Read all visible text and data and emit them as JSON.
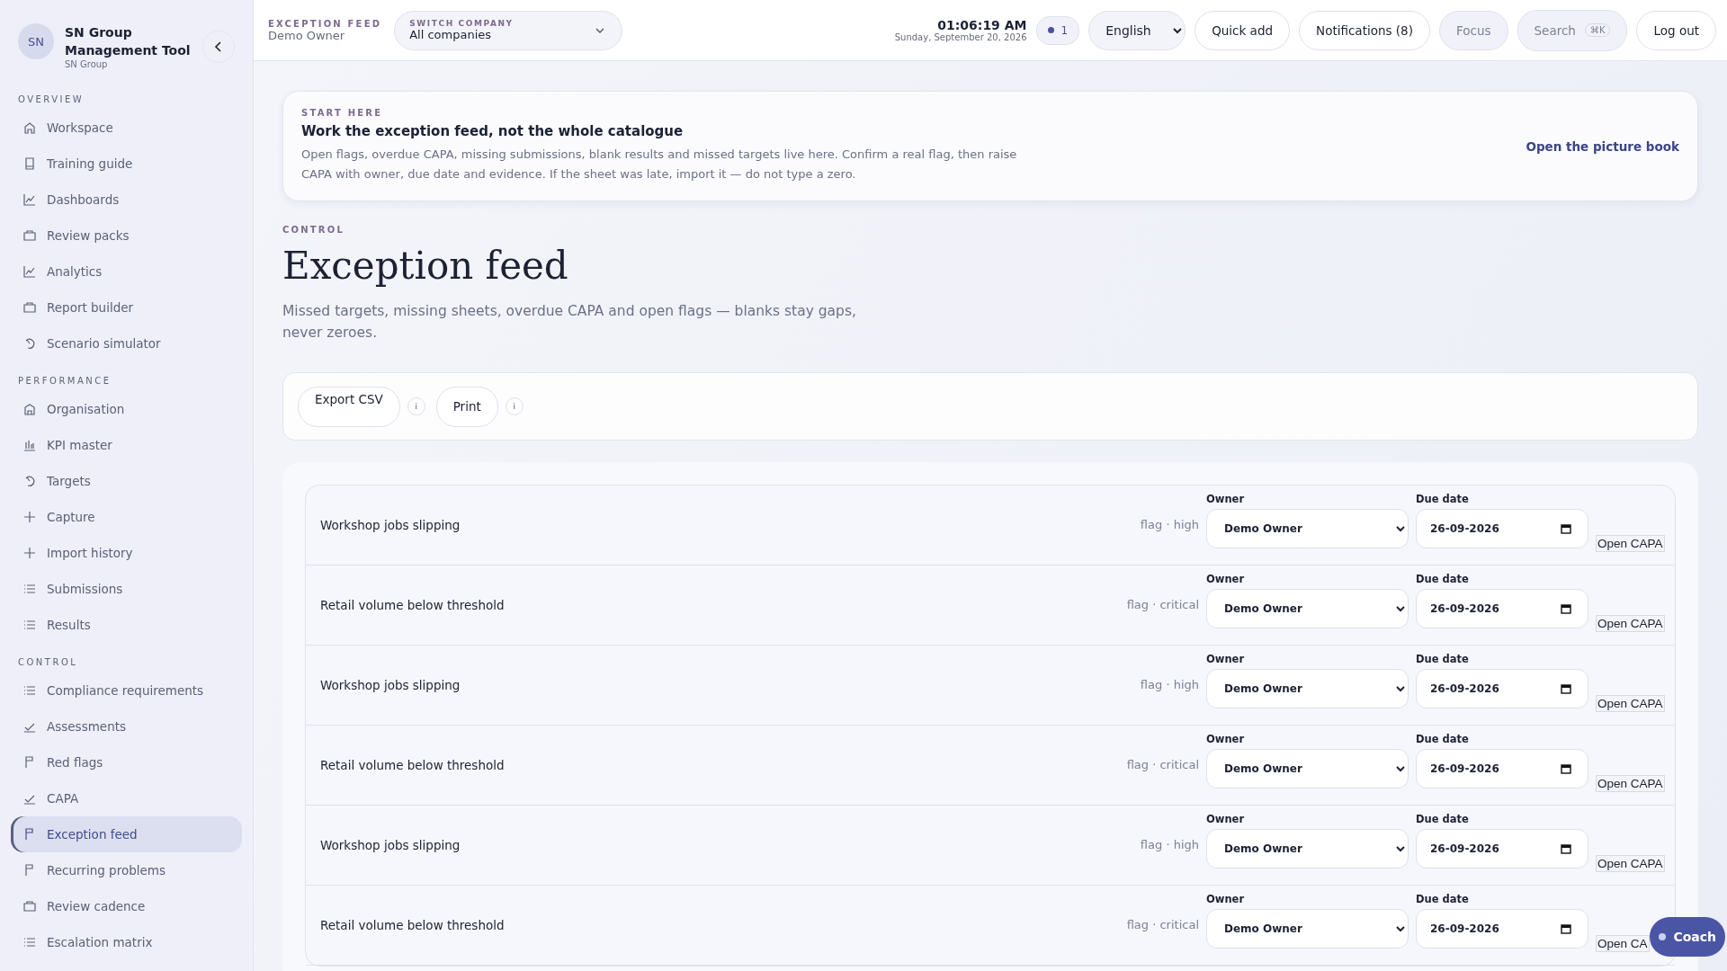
{
  "sidebar": {
    "avatar": "SN",
    "title": "SN Group Management Tool",
    "subtitle": "SN Group",
    "sections": [
      {
        "heading": "OVERVIEW",
        "items": [
          {
            "label": "Workspace",
            "kind": "home",
            "selected": false
          },
          {
            "label": "Training guide",
            "kind": "book",
            "selected": false
          },
          {
            "label": "Dashboards",
            "kind": "chart",
            "selected": false
          },
          {
            "label": "Review packs",
            "kind": "folder",
            "selected": false
          },
          {
            "label": "Analytics",
            "kind": "chart",
            "selected": false
          },
          {
            "label": "Report builder",
            "kind": "folder",
            "selected": false
          },
          {
            "label": "Scenario simulator",
            "kind": "gauge",
            "selected": false
          }
        ]
      },
      {
        "heading": "PERFORMANCE",
        "items": [
          {
            "label": "Organisation",
            "kind": "building",
            "selected": false
          },
          {
            "label": "KPI master",
            "kind": "bars",
            "selected": false
          },
          {
            "label": "Targets",
            "kind": "gauge",
            "selected": false
          },
          {
            "label": "Capture",
            "kind": "plus",
            "selected": false
          },
          {
            "label": "Import history",
            "kind": "plus",
            "selected": false
          },
          {
            "label": "Submissions",
            "kind": "list",
            "selected": false
          },
          {
            "label": "Results",
            "kind": "list",
            "selected": false
          }
        ]
      },
      {
        "heading": "CONTROL",
        "items": [
          {
            "label": "Compliance requirements",
            "kind": "list",
            "selected": false
          },
          {
            "label": "Assessments",
            "kind": "check",
            "selected": false
          },
          {
            "label": "Red flags",
            "kind": "flag",
            "selected": false
          },
          {
            "label": "CAPA",
            "kind": "check",
            "selected": false
          },
          {
            "label": "Exception feed",
            "kind": "flag",
            "selected": true
          },
          {
            "label": "Recurring problems",
            "kind": "flag",
            "selected": false
          },
          {
            "label": "Review cadence",
            "kind": "folder",
            "selected": false
          },
          {
            "label": "Escalation matrix",
            "kind": "list",
            "selected": false
          }
        ]
      }
    ]
  },
  "topbar": {
    "eyebrow": "EXCEPTION FEED",
    "user": "Demo Owner",
    "company_label": "SWITCH COMPANY",
    "company": "All companies",
    "time": "01:06:19 AM",
    "date": "Sunday, September 20, 2026",
    "status_count": "1",
    "language": "English",
    "quick_add": "Quick add",
    "notifications": "Notifications (8)",
    "focus": "Focus",
    "search": "Search",
    "search_shortcut": "⌘K",
    "logout": "Log out"
  },
  "banner": {
    "eyebrow": "START HERE",
    "title": "Work the exception feed, not the whole catalogue",
    "text": "Open flags, overdue CAPA, missing submissions, blank results and missed targets live here. Confirm a real flag, then raise CAPA with owner, due date and evidence. If the sheet was late, import it — do not type a zero.",
    "link": "Open the picture book"
  },
  "page": {
    "eyebrow": "CONTROL",
    "title": "Exception feed",
    "subtitle": "Missed targets, missing sheets, overdue CAPA and open flags — blanks stay gaps, never zeroes."
  },
  "actions": [
    {
      "label": "Export CSV",
      "info": "i"
    },
    {
      "label": "Print",
      "info": "i"
    }
  ],
  "rows": [
    {
      "title": "Workshop jobs slipping",
      "meta": "flag · high",
      "owner_label": "Owner",
      "owner": "Demo Owner",
      "due_label": "Due date",
      "due": "26-09-2026",
      "open": "Open CAPA"
    },
    {
      "title": "Retail volume below threshold",
      "meta": "flag · critical",
      "owner_label": "Owner",
      "owner": "Demo Owner",
      "due_label": "Due date",
      "due": "26-09-2026",
      "open": "Open CAPA"
    },
    {
      "title": "Workshop jobs slipping",
      "meta": "flag · high",
      "owner_label": "Owner",
      "owner": "Demo Owner",
      "due_label": "Due date",
      "due": "26-09-2026",
      "open": "Open CAPA"
    },
    {
      "title": "Retail volume below threshold",
      "meta": "flag · critical",
      "owner_label": "Owner",
      "owner": "Demo Owner",
      "due_label": "Due date",
      "due": "26-09-2026",
      "open": "Open CAPA"
    },
    {
      "title": "Workshop jobs slipping",
      "meta": "flag · high",
      "owner_label": "Owner",
      "owner": "Demo Owner",
      "due_label": "Due date",
      "due": "26-09-2026",
      "open": "Open CAPA"
    },
    {
      "title": "Retail volume below threshold",
      "meta": "flag · critical",
      "owner_label": "Owner",
      "owner": "Demo Owner",
      "due_label": "Due date",
      "due": "26-09-2026",
      "open": "Open CA"
    }
  ],
  "coach": "Coach"
}
